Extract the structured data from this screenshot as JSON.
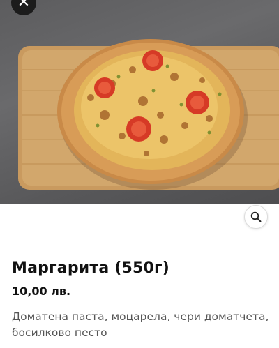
{
  "product": {
    "title": "Маргарита (550г)",
    "price": "10,00 лв.",
    "description": "Доматена паста, моцарела, чери доматчета, босилково песто"
  },
  "buttons": {
    "close_glyph": "✕"
  },
  "image": {
    "subject": "pizza-on-wooden-board"
  },
  "colors": {
    "close_button_bg": "#1c1c1c",
    "zoom_button_bg": "#ffffff",
    "title_text": "#111111",
    "description_text": "#555555"
  }
}
